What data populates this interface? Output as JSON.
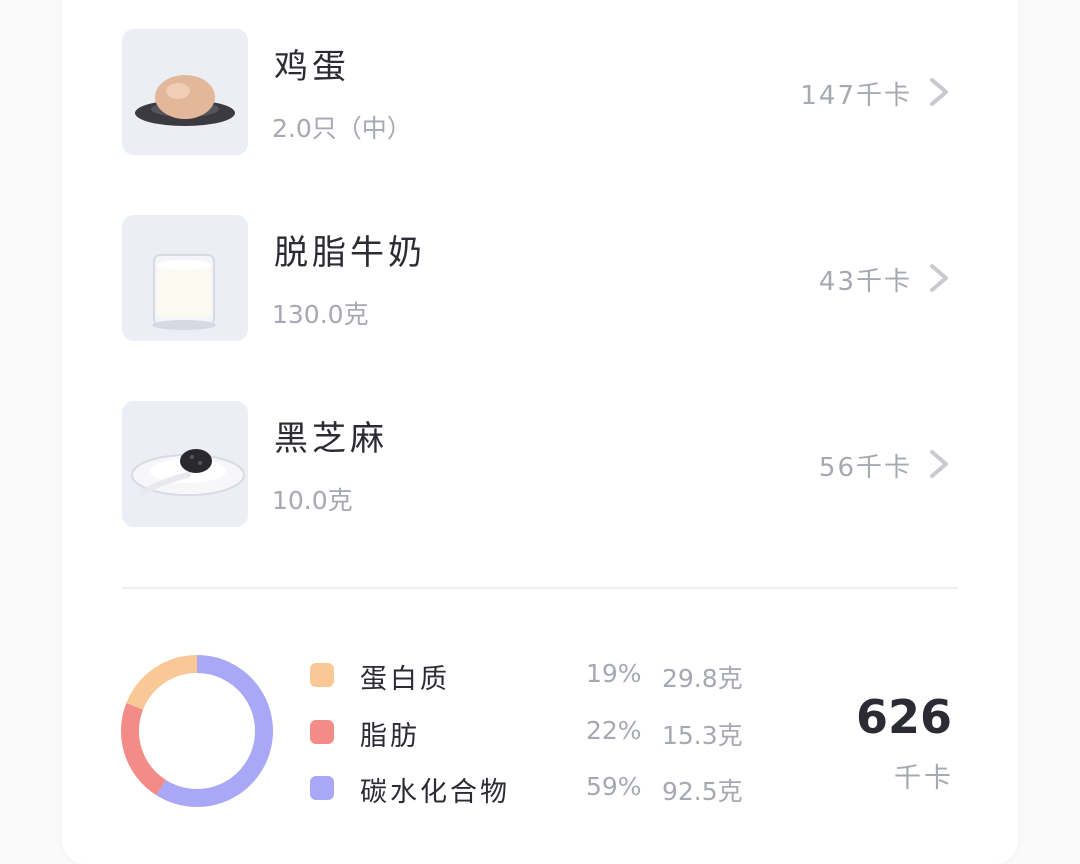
{
  "foods": [
    {
      "name": "鸡蛋",
      "amount": "2.0只（中）",
      "kcal": "147千卡",
      "image_icon": "egg-photo"
    },
    {
      "name": "脱脂牛奶",
      "amount": "130.0克",
      "kcal": "43千卡",
      "image_icon": "milk-photo"
    },
    {
      "name": "黑芝麻",
      "amount": "10.0克",
      "kcal": "56千卡",
      "image_icon": "sesame-photo"
    }
  ],
  "nutrition": {
    "chart_data": {
      "type": "pie",
      "categories": [
        "蛋白质",
        "脂肪",
        "碳水化合物"
      ],
      "values": [
        19,
        22,
        59
      ],
      "colors": [
        "#fac896",
        "#f38c86",
        "#a8a8f6"
      ]
    },
    "legend": [
      {
        "name": "蛋白质",
        "percent": "19%",
        "grams": "29.8克",
        "color": "#fac896"
      },
      {
        "name": "脂肪",
        "percent": "22%",
        "grams": "15.3克",
        "color": "#f38c86"
      },
      {
        "name": "碳水化合物",
        "percent": "59%",
        "grams": "92.5克",
        "color": "#a8a8f6"
      }
    ],
    "total_kcal": "626",
    "total_unit": "千卡"
  }
}
